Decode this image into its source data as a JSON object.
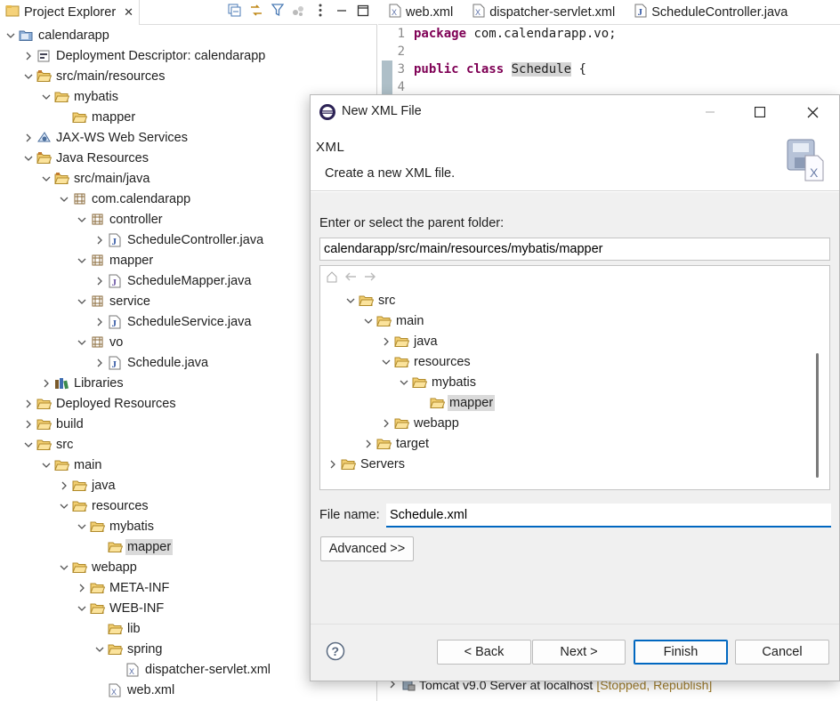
{
  "explorer": {
    "title": "Project Explorer",
    "tree": [
      {
        "label": "calendarapp",
        "depth": 0,
        "state": "open",
        "icon": "project-icon"
      },
      {
        "label": "Deployment Descriptor: calendarapp",
        "depth": 1,
        "state": "closed",
        "icon": "descriptor-icon"
      },
      {
        "label": "src/main/resources",
        "depth": 1,
        "state": "open",
        "icon": "source-folder-icon"
      },
      {
        "label": "mybatis",
        "depth": 2,
        "state": "open",
        "icon": "folder-open-icon"
      },
      {
        "label": "mapper",
        "depth": 3,
        "state": "none",
        "icon": "folder-open-icon"
      },
      {
        "label": "JAX-WS Web Services",
        "depth": 1,
        "state": "closed",
        "icon": "webservices-icon"
      },
      {
        "label": "Java Resources",
        "depth": 1,
        "state": "open",
        "icon": "java-resources-icon"
      },
      {
        "label": "src/main/java",
        "depth": 2,
        "state": "open",
        "icon": "source-folder-icon"
      },
      {
        "label": "com.calendarapp",
        "depth": 3,
        "state": "open",
        "icon": "package-icon"
      },
      {
        "label": "controller",
        "depth": 4,
        "state": "open",
        "icon": "package-icon"
      },
      {
        "label": "ScheduleController.java",
        "depth": 5,
        "state": "closed",
        "icon": "java-file-icon"
      },
      {
        "label": "mapper",
        "depth": 4,
        "state": "open",
        "icon": "package-icon"
      },
      {
        "label": "ScheduleMapper.java",
        "depth": 5,
        "state": "closed",
        "icon": "java-interface-icon"
      },
      {
        "label": "service",
        "depth": 4,
        "state": "open",
        "icon": "package-icon"
      },
      {
        "label": "ScheduleService.java",
        "depth": 5,
        "state": "closed",
        "icon": "java-file-icon"
      },
      {
        "label": "vo",
        "depth": 4,
        "state": "open",
        "icon": "package-icon"
      },
      {
        "label": "Schedule.java",
        "depth": 5,
        "state": "closed",
        "icon": "java-file-icon"
      },
      {
        "label": "Libraries",
        "depth": 2,
        "state": "closed",
        "icon": "libraries-icon"
      },
      {
        "label": "Deployed Resources",
        "depth": 1,
        "state": "closed",
        "icon": "folder-open-icon"
      },
      {
        "label": "build",
        "depth": 1,
        "state": "closed",
        "icon": "folder-open-icon"
      },
      {
        "label": "src",
        "depth": 1,
        "state": "open",
        "icon": "folder-open-icon"
      },
      {
        "label": "main",
        "depth": 2,
        "state": "open",
        "icon": "folder-open-icon"
      },
      {
        "label": "java",
        "depth": 3,
        "state": "closed",
        "icon": "folder-open-icon"
      },
      {
        "label": "resources",
        "depth": 3,
        "state": "open",
        "icon": "folder-open-icon"
      },
      {
        "label": "mybatis",
        "depth": 4,
        "state": "open",
        "icon": "folder-open-icon"
      },
      {
        "label": "mapper",
        "depth": 5,
        "state": "none",
        "icon": "folder-open-icon",
        "selected": true
      },
      {
        "label": "webapp",
        "depth": 3,
        "state": "open",
        "icon": "folder-open-icon"
      },
      {
        "label": "META-INF",
        "depth": 4,
        "state": "closed",
        "icon": "folder-open-icon"
      },
      {
        "label": "WEB-INF",
        "depth": 4,
        "state": "open",
        "icon": "folder-open-icon"
      },
      {
        "label": "lib",
        "depth": 5,
        "state": "none",
        "icon": "folder-open-icon"
      },
      {
        "label": "spring",
        "depth": 5,
        "state": "open",
        "icon": "folder-open-icon"
      },
      {
        "label": "dispatcher-servlet.xml",
        "depth": 6,
        "state": "none",
        "icon": "xml-file-icon"
      },
      {
        "label": "web.xml",
        "depth": 5,
        "state": "none",
        "icon": "xml-file-icon"
      }
    ]
  },
  "editor": {
    "tabs": [
      {
        "label": "web.xml",
        "icon": "xml-file-icon"
      },
      {
        "label": "dispatcher-servlet.xml",
        "icon": "xml-file-icon"
      },
      {
        "label": "ScheduleController.java",
        "icon": "java-file-icon"
      }
    ],
    "lines": [
      {
        "num": "1",
        "kw": "package",
        "rest": " com.calendarapp.vo;"
      },
      {
        "num": "2",
        "kw": "",
        "rest": ""
      },
      {
        "num": "3",
        "kw": "public class",
        "rest": "Schedule",
        "tail": " {"
      },
      {
        "num": "4",
        "kw": "",
        "rest": ""
      }
    ],
    "console": {
      "server": "Tomcat v9.0 Server at localhost",
      "status": "[Stopped, Republish]"
    }
  },
  "dialog": {
    "title": "New XML File",
    "banner_title": "XML",
    "banner_desc": "Create a new XML file.",
    "parent_label": "Enter or select the parent folder:",
    "parent_value": "calendarapp/src/main/resources/mybatis/mapper",
    "folder_tree": [
      {
        "label": "src",
        "depth": 1,
        "state": "open"
      },
      {
        "label": "main",
        "depth": 2,
        "state": "open"
      },
      {
        "label": "java",
        "depth": 3,
        "state": "closed"
      },
      {
        "label": "resources",
        "depth": 3,
        "state": "open"
      },
      {
        "label": "mybatis",
        "depth": 4,
        "state": "open"
      },
      {
        "label": "mapper",
        "depth": 5,
        "state": "none",
        "selected": true
      },
      {
        "label": "webapp",
        "depth": 3,
        "state": "closed"
      },
      {
        "label": "target",
        "depth": 2,
        "state": "closed"
      },
      {
        "label": "Servers",
        "depth": 0,
        "state": "closed"
      }
    ],
    "file_label": "File name:",
    "file_value": "Schedule.xml",
    "advanced_label": "Advanced >>",
    "back_label": "< Back",
    "next_label": "Next >",
    "finish_label": "Finish",
    "cancel_label": "Cancel"
  }
}
